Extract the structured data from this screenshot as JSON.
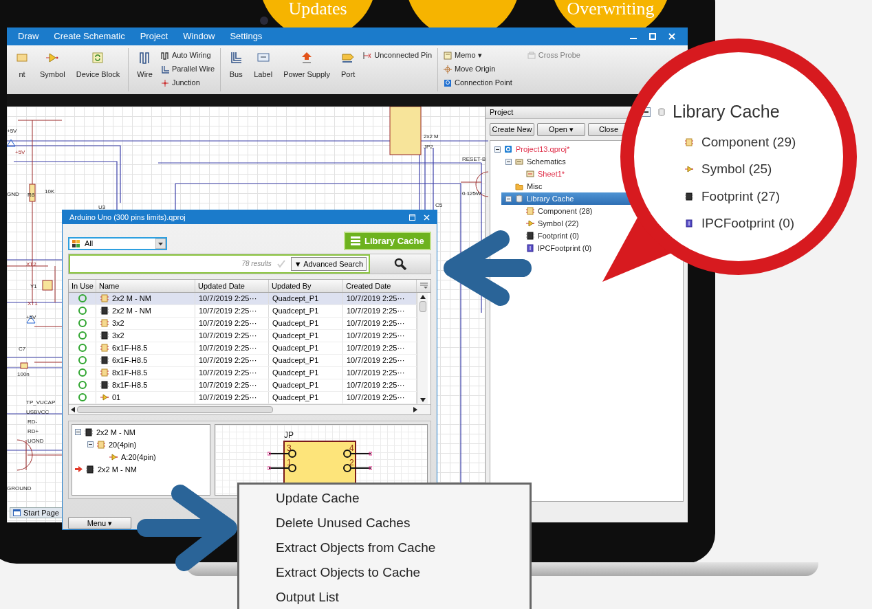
{
  "badges": [
    {
      "text": "Updates"
    },
    {
      "text": "Overwriting"
    }
  ],
  "app": {
    "menu": [
      "Draw",
      "Create Schematic",
      "Project",
      "Window",
      "Settings"
    ],
    "ribbon": [
      {
        "items": [
          {
            "label": "nt",
            "kind": "large",
            "disabled": false
          },
          {
            "label": "Symbol",
            "kind": "large",
            "disabled": false
          },
          {
            "label": "Device Block",
            "kind": "large",
            "disabled": false
          }
        ]
      },
      {
        "items": [
          {
            "label": "Wire",
            "kind": "large",
            "disabled": false
          },
          {
            "label": "Auto Wiring",
            "kind": "small",
            "disabled": false
          },
          {
            "label": "Parallel Wire",
            "kind": "small",
            "disabled": false
          },
          {
            "label": "Junction",
            "kind": "small",
            "disabled": false
          }
        ]
      },
      {
        "items": [
          {
            "label": "Bus",
            "kind": "large",
            "disabled": false
          },
          {
            "label": "Label",
            "kind": "large",
            "disabled": false
          },
          {
            "label": "Power Supply",
            "kind": "large",
            "disabled": false
          },
          {
            "label": "Port",
            "kind": "large",
            "disabled": false
          },
          {
            "label": "Unconnected Pin",
            "kind": "small",
            "disabled": false
          }
        ]
      },
      {
        "items": [
          {
            "label": "Memo ▾",
            "kind": "small",
            "disabled": false
          },
          {
            "label": "Move Origin",
            "kind": "small",
            "disabled": false
          },
          {
            "label": "Connection Point",
            "kind": "small",
            "disabled": false
          },
          {
            "label": "Cross Probe",
            "kind": "small",
            "disabled": true
          }
        ]
      }
    ],
    "schematic_labels": [
      "+5V",
      "+5V",
      "GND",
      "R8",
      "10K",
      "XT2",
      "Y1",
      "XT1",
      "+5V",
      "C7",
      "100n",
      "TP_VUCAP",
      "USBVCC",
      "RD-",
      "RD+",
      "UGND",
      "GROUND",
      "U3",
      "2x2 M",
      "JP2",
      "RESET-B",
      "0.125W",
      "C5"
    ],
    "start_tab": "Start Page",
    "project_panel": {
      "title": "Project",
      "buttons": [
        "Create New",
        "Open ▾",
        "Close"
      ],
      "tree": [
        {
          "label": "Project13.qproj*",
          "kind": "project",
          "modified": true,
          "selected": false,
          "expanded": true,
          "children": [
            {
              "label": "Schematics",
              "kind": "schematics",
              "modified": false,
              "selected": false,
              "expanded": true,
              "children": [
                {
                  "label": "Sheet1*",
                  "kind": "sheet",
                  "modified": true,
                  "selected": false
                }
              ]
            },
            {
              "label": "Misc",
              "kind": "folder",
              "modified": false,
              "selected": false
            },
            {
              "label": "Library Cache",
              "kind": "cache",
              "modified": false,
              "selected": true,
              "expanded": true,
              "children": [
                {
                  "label": "Component (28)",
                  "kind": "component",
                  "modified": false,
                  "selected": false
                },
                {
                  "label": "Symbol (22)",
                  "kind": "symbol",
                  "modified": false,
                  "selected": false
                },
                {
                  "label": "Footprint (0)",
                  "kind": "footprint",
                  "modified": false,
                  "selected": false
                },
                {
                  "label": "IPCFootprint (0)",
                  "kind": "ipc",
                  "modified": false,
                  "selected": false
                }
              ]
            }
          ]
        }
      ]
    }
  },
  "dialog": {
    "title": "Arduino Uno (300 pins limits).qproj",
    "filter": "All",
    "cache_button": "Library Cache",
    "result_count": "78 results",
    "advanced_search": "▼ Advanced Search",
    "columns": [
      "In Use",
      "Name",
      "Updated Date",
      "Updated By",
      "Created Date"
    ],
    "rows": [
      {
        "in_use": true,
        "kind": "component",
        "name": "2x2 M - NM",
        "updated": "10/7/2019 2:25···",
        "by": "Quadcept_P1",
        "created": "10/7/2019 2:25···",
        "selected": true
      },
      {
        "in_use": true,
        "kind": "footprint",
        "name": "2x2 M - NM",
        "updated": "10/7/2019 2:25···",
        "by": "Quadcept_P1",
        "created": "10/7/2019 2:25···",
        "selected": false
      },
      {
        "in_use": true,
        "kind": "component",
        "name": "3x2",
        "updated": "10/7/2019 2:25···",
        "by": "Quadcept_P1",
        "created": "10/7/2019 2:25···",
        "selected": false
      },
      {
        "in_use": true,
        "kind": "footprint",
        "name": "3x2",
        "updated": "10/7/2019 2:25···",
        "by": "Quadcept_P1",
        "created": "10/7/2019 2:25···",
        "selected": false
      },
      {
        "in_use": true,
        "kind": "component",
        "name": "6x1F-H8.5",
        "updated": "10/7/2019 2:25···",
        "by": "Quadcept_P1",
        "created": "10/7/2019 2:25···",
        "selected": false
      },
      {
        "in_use": true,
        "kind": "footprint",
        "name": "6x1F-H8.5",
        "updated": "10/7/2019 2:25···",
        "by": "Quadcept_P1",
        "created": "10/7/2019 2:25···",
        "selected": false
      },
      {
        "in_use": true,
        "kind": "component",
        "name": "8x1F-H8.5",
        "updated": "10/7/2019 2:25···",
        "by": "Quadcept_P1",
        "created": "10/7/2019 2:25···",
        "selected": false
      },
      {
        "in_use": true,
        "kind": "footprint",
        "name": "8x1F-H8.5",
        "updated": "10/7/2019 2:25···",
        "by": "Quadcept_P1",
        "created": "10/7/2019 2:25···",
        "selected": false
      },
      {
        "in_use": true,
        "kind": "symbol",
        "name": "01",
        "updated": "10/7/2019 2:25···",
        "by": "Quadcept_P1",
        "created": "10/7/2019 2:25···",
        "selected": false
      }
    ],
    "detail_tree": [
      {
        "label": "2x2 M - NM",
        "kind": "footprint",
        "current": false,
        "expanded": true,
        "children": [
          {
            "label": "20(4pin)",
            "kind": "component",
            "current": false,
            "expanded": true,
            "children": [
              {
                "label": "A:20(4pin)",
                "kind": "symbol",
                "current": false
              }
            ]
          }
        ]
      },
      {
        "label": "2x2 M - NM",
        "kind": "footprint",
        "current": true
      }
    ],
    "preview": {
      "ref": "JP",
      "pins": [
        "3",
        "1",
        "4",
        "2"
      ]
    },
    "menu_button": "Menu ▾"
  },
  "context_menu": [
    "Update Cache",
    "Delete Unused Caches",
    "Extract Objects from Cache",
    "Extract Objects to Cache",
    "Output List"
  ],
  "magnifier": {
    "label": "Library Cache",
    "expanded": true,
    "children": [
      {
        "label": "Component (29)",
        "kind": "component"
      },
      {
        "label": "Symbol (25)",
        "kind": "symbol"
      },
      {
        "label": "Footprint (27)",
        "kind": "footprint"
      },
      {
        "label": "IPCFootprint (0)",
        "kind": "ipc"
      }
    ]
  }
}
